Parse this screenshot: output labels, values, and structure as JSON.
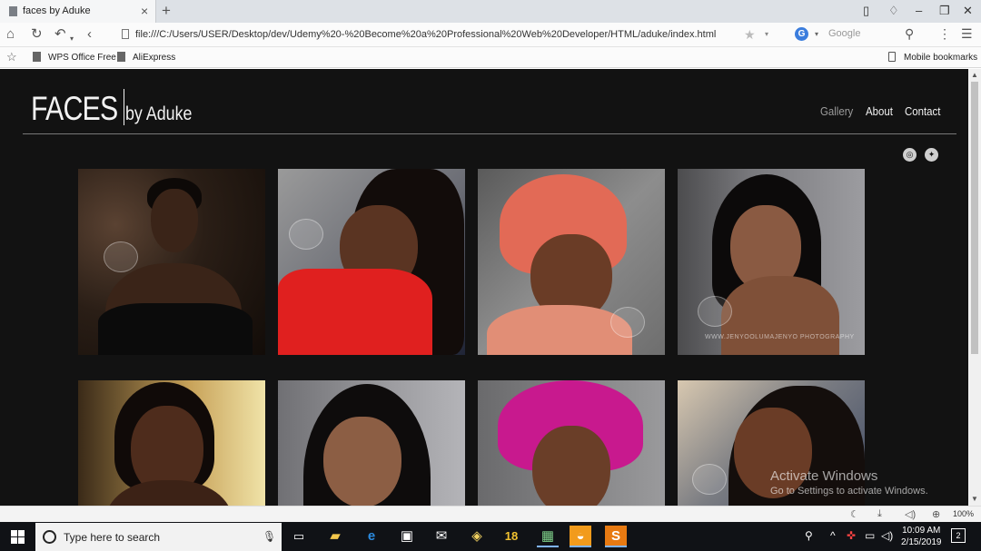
{
  "browser": {
    "tab_title": "faces by Aduke",
    "url": "file:///C:/Users/USER/Desktop/dev/Udemy%20-%20Become%20a%20Professional%20Web%20Developer/HTML/aduke/index.html",
    "search_placeholder": "Google",
    "search_engine_letter": "G",
    "bookmarks": [
      "WPS Office Free",
      "AliExpress"
    ],
    "mobile_bookmarks": "Mobile bookmarks",
    "zoom": "100%"
  },
  "site": {
    "logo_main": "FACES",
    "logo_sub": "by Aduke",
    "nav": [
      "Gallery",
      "About",
      "Contact"
    ],
    "watermark_text": "WWW.JENYOOLUMAJENYO PHOTOGRAPHY"
  },
  "overlay": {
    "activate_title": "Activate Windows",
    "activate_sub": "Go to Settings to activate Windows."
  },
  "taskbar": {
    "search_placeholder": "Type here to search",
    "badge_18": "18",
    "time": "10:09 AM",
    "date": "2/15/2019",
    "notifications": "2"
  }
}
